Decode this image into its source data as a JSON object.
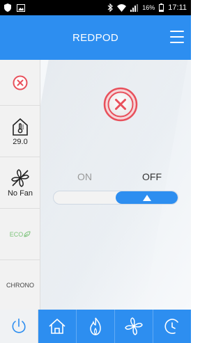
{
  "status_bar": {
    "battery_percent": "16%",
    "time": "17:11"
  },
  "app_bar": {
    "title": "REDPOD"
  },
  "sidebar": {
    "temperature": "29.0",
    "fan_label": "No Fan",
    "eco_label": "ECO",
    "chrono_label": "CHRONO"
  },
  "main": {
    "on_label": "ON",
    "off_label": "OFF",
    "power_state": "off"
  },
  "colors": {
    "accent": "#2d8ef0",
    "error": "#e8505b",
    "eco": "#7cc37a"
  },
  "icons": {
    "status": [
      "shield-icon",
      "image-icon",
      "bluetooth-icon",
      "wifi-icon",
      "signal-icon",
      "battery-icon"
    ],
    "sidebar": [
      "error-icon",
      "house-thermometer-icon",
      "fan-icon",
      "leaf-icon"
    ],
    "bottom_tabs": [
      "power-icon",
      "home-icon",
      "flame-icon",
      "fan-icon",
      "clock-icon"
    ]
  }
}
